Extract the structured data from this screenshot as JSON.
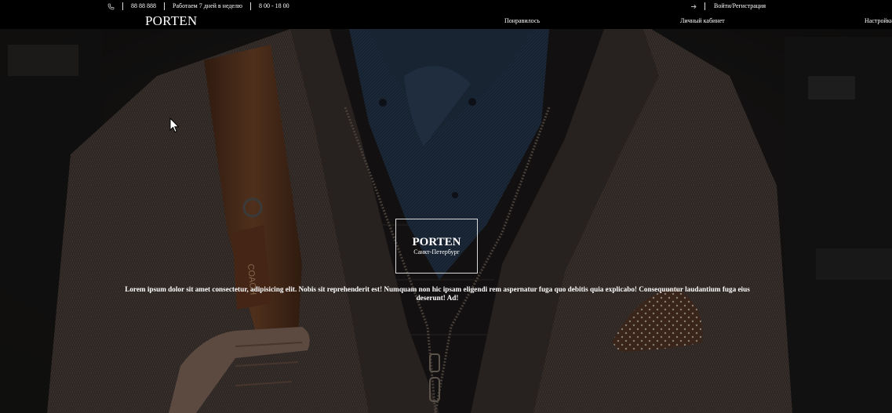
{
  "topbar": {
    "phone_icon": "phone-icon",
    "phone": "88 88 888",
    "hours_label": "Работаем 7 дней в неделю",
    "hours": "8 00 - 18 00",
    "login_icon": "login-arrow-icon",
    "login": "Войти/Регистрация"
  },
  "navbar": {
    "logo": "PORTEN",
    "links": [
      "Понравилось",
      "Личный кабинет",
      "Настройки"
    ]
  },
  "hero": {
    "brand": "PORTEN",
    "city": "Санкт-Петербург",
    "text": "Lorem ipsum dolor sit amet consectetur, adipisicing elit. Nobis sit reprehenderit est! Numquam non hic ipsam eligendi rem aspernatur fuga quo debitis quia explicabo! Consequuntur laudantium fuga eius deserunt! Ad!"
  },
  "colors": {
    "bar_background": "#000000",
    "text": "#ffffff",
    "jacket": "#4a3f3a",
    "strap": "#6b3f24",
    "shirt": "#243447",
    "pocket_square": "#5a3a2a"
  }
}
